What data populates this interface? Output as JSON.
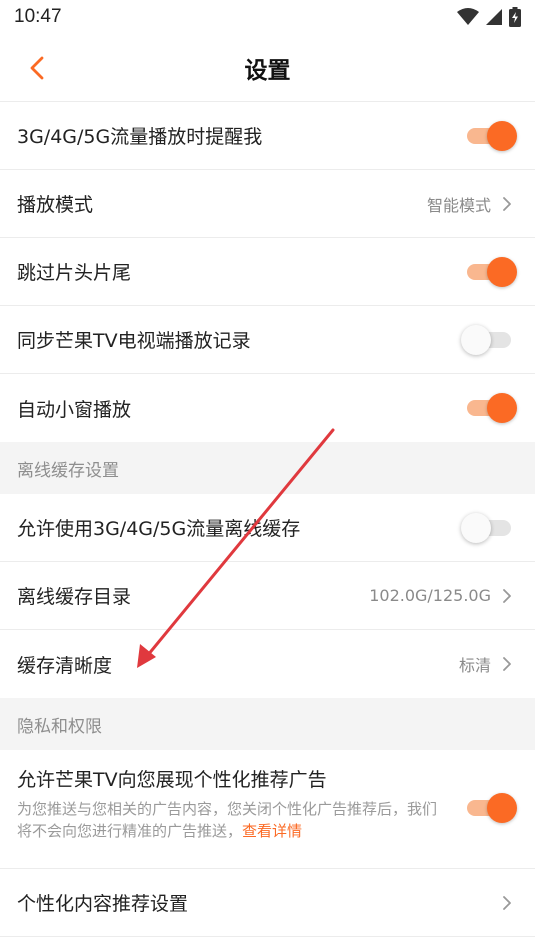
{
  "status_bar": {
    "time": "10:47",
    "icons": [
      "wifi-icon",
      "signal-icon",
      "battery-charging-icon"
    ]
  },
  "header": {
    "title": "设置",
    "back_icon": "chevron-left-icon",
    "accent_color": "#fb6a24"
  },
  "playback": {
    "items": [
      {
        "label": "3G/4G/5G流量播放时提醒我",
        "type": "toggle",
        "on": true
      },
      {
        "label": "播放模式",
        "type": "link",
        "value": "智能模式"
      },
      {
        "label": "跳过片头片尾",
        "type": "toggle",
        "on": true
      },
      {
        "label": "同步芒果TV电视端播放记录",
        "type": "toggle",
        "on": false
      },
      {
        "label": "自动小窗播放",
        "type": "toggle",
        "on": true
      }
    ]
  },
  "offline": {
    "section_title": "离线缓存设置",
    "items": [
      {
        "label": "允许使用3G/4G/5G流量离线缓存",
        "type": "toggle",
        "on": false
      },
      {
        "label": "离线缓存目录",
        "type": "link",
        "value": "102.0G/125.0G"
      },
      {
        "label": "缓存清晰度",
        "type": "link",
        "value": "标清"
      }
    ]
  },
  "privacy": {
    "section_title": "隐私和权限",
    "ad_item": {
      "label": "允许芒果TV向您展现个性化推荐广告",
      "description": "为您推送与您相关的广告内容，您关闭个性化广告推荐后，我们将不会向您进行精准的广告推送，",
      "link": "查看详情",
      "on": true
    },
    "content_item": {
      "label": "个性化内容推荐设置",
      "type": "link"
    }
  },
  "annotation": {
    "color": "#e0393e"
  }
}
